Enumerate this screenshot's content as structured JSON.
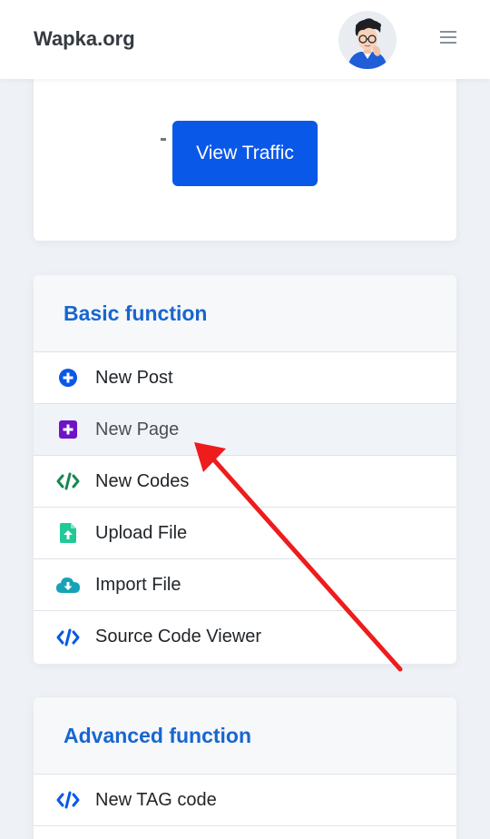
{
  "navbar": {
    "brand": "Wapka.org",
    "avatar_icon": "user-avatar-icon",
    "menu_icon": "hamburger-menu-icon"
  },
  "traffic_card": {
    "button_label": "View Traffic"
  },
  "basic": {
    "title": "Basic function",
    "items": [
      {
        "label": "New Post",
        "icon": "plus-circle-icon",
        "color": "#0a58e8"
      },
      {
        "label": "New Page",
        "icon": "plus-square-icon",
        "color": "#6f13c7"
      },
      {
        "label": "New Codes",
        "icon": "code-icon",
        "color": "#198754"
      },
      {
        "label": "Upload File",
        "icon": "file-upload-icon",
        "color": "#20c997"
      },
      {
        "label": "Import File",
        "icon": "cloud-download-icon",
        "color": "#17a2b8"
      },
      {
        "label": "Source Code Viewer",
        "icon": "code-icon",
        "color": "#0a58e8"
      }
    ]
  },
  "advanced": {
    "title": "Advanced function",
    "items": [
      {
        "label": "New TAG code",
        "icon": "code-icon",
        "color": "#0a58e8"
      }
    ]
  },
  "colors": {
    "primary": "#0a58e8",
    "title_blue": "#1766d0",
    "annotation_arrow": "#ee1c1c"
  }
}
